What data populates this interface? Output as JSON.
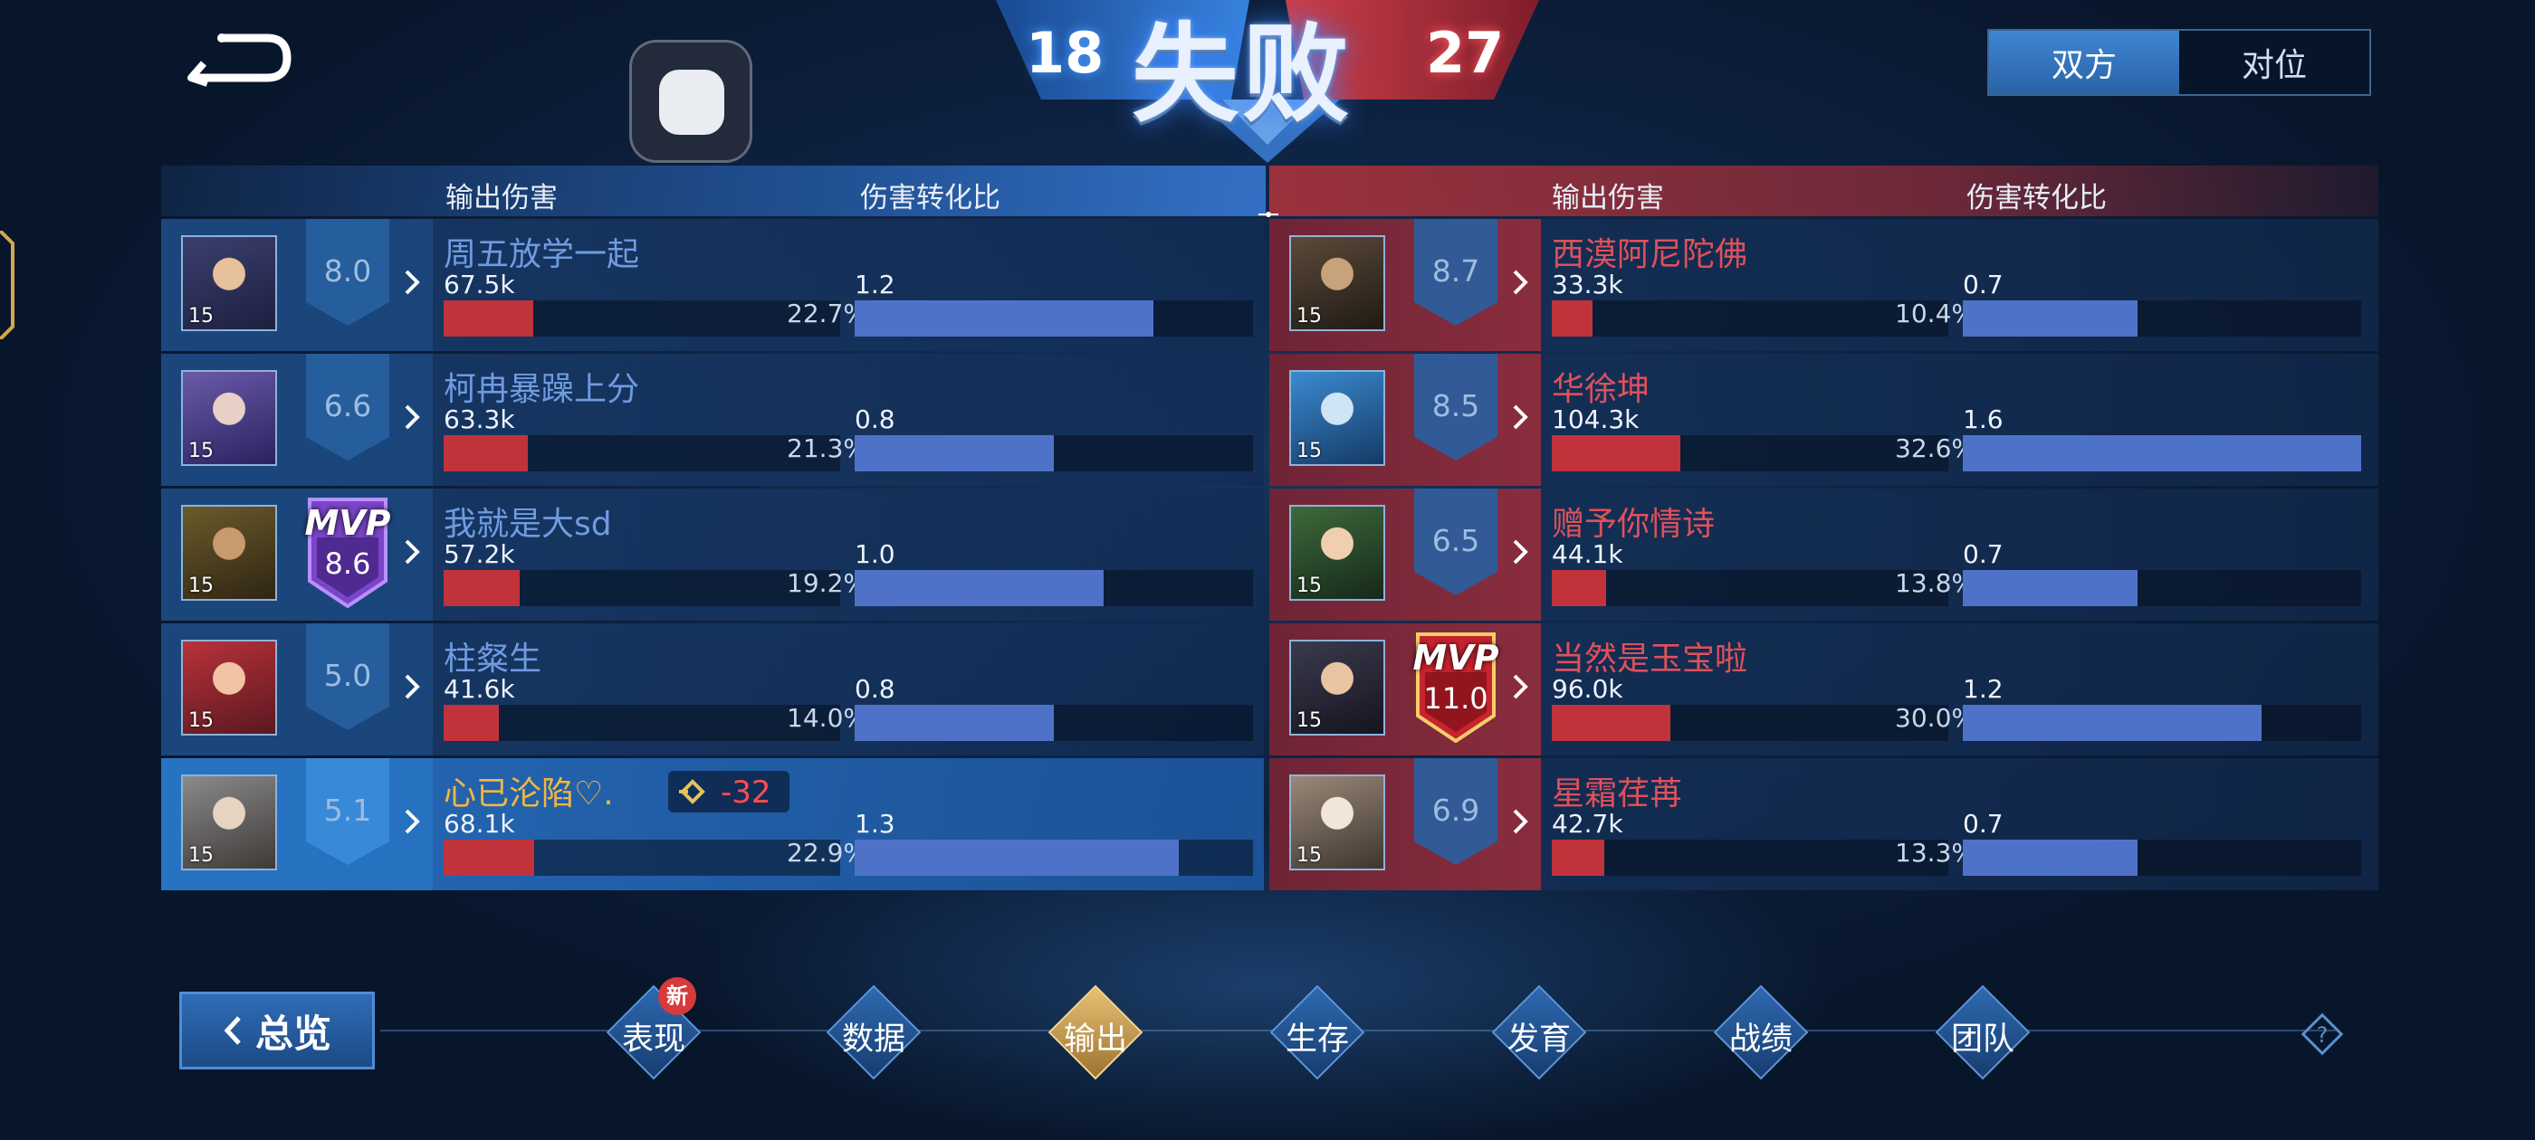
{
  "header": {
    "result": "失败",
    "score_ally": "18",
    "score_enemy": "27",
    "view_toggle": [
      {
        "label": "双方",
        "active": true
      },
      {
        "label": "对位",
        "active": false
      }
    ]
  },
  "columns": {
    "damage": "输出伤害",
    "conversion": "伤害转化比"
  },
  "ally": [
    {
      "name": "周五放学一起",
      "rating": "8.0",
      "level": "15",
      "damage": "67.5k",
      "damage_pct": "22.7%",
      "damage_share": 0.227,
      "ratio": "1.2",
      "ratio_value": 1.2,
      "mvp": false
    },
    {
      "name": "柯冉暴躁上分",
      "rating": "6.6",
      "level": "15",
      "damage": "63.3k",
      "damage_pct": "21.3%",
      "damage_share": 0.213,
      "ratio": "0.8",
      "ratio_value": 0.8,
      "mvp": false
    },
    {
      "name": "我就是大sd",
      "rating": "8.6",
      "level": "15",
      "damage": "57.2k",
      "damage_pct": "19.2%",
      "damage_share": 0.192,
      "ratio": "1.0",
      "ratio_value": 1.0,
      "mvp": true,
      "mvp_label": "MVP"
    },
    {
      "name": "柱粲生",
      "rating": "5.0",
      "level": "15",
      "damage": "41.6k",
      "damage_pct": "14.0%",
      "damage_share": 0.14,
      "ratio": "0.8",
      "ratio_value": 0.8,
      "mvp": false
    },
    {
      "name": "心已沦陷♡.",
      "rating": "5.1",
      "level": "15",
      "damage": "68.1k",
      "damage_pct": "22.9%",
      "damage_share": 0.229,
      "ratio": "1.3",
      "ratio_value": 1.3,
      "mvp": false,
      "is_self": true,
      "rank_change": "-32"
    }
  ],
  "enemy": [
    {
      "name": "西漠阿尼陀佛",
      "rating": "8.7",
      "level": "15",
      "damage": "33.3k",
      "damage_pct": "10.4%",
      "damage_share": 0.104,
      "ratio": "0.7",
      "ratio_value": 0.7,
      "mvp": false
    },
    {
      "name": "华徐坤",
      "rating": "8.5",
      "level": "15",
      "damage": "104.3k",
      "damage_pct": "32.6%",
      "damage_share": 0.326,
      "ratio": "1.6",
      "ratio_value": 1.6,
      "mvp": false
    },
    {
      "name": "赠予你情诗",
      "rating": "6.5",
      "level": "15",
      "damage": "44.1k",
      "damage_pct": "13.8%",
      "damage_share": 0.138,
      "ratio": "0.7",
      "ratio_value": 0.7,
      "mvp": false
    },
    {
      "name": "当然是玉宝啦",
      "rating": "11.0",
      "level": "15",
      "damage": "96.0k",
      "damage_pct": "30.0%",
      "damage_share": 0.3,
      "ratio": "1.2",
      "ratio_value": 1.2,
      "mvp": true,
      "mvp_label": "MVP"
    },
    {
      "name": "星霜荏苒",
      "rating": "6.9",
      "level": "15",
      "damage": "42.7k",
      "damage_pct": "13.3%",
      "damage_share": 0.133,
      "ratio": "0.7",
      "ratio_value": 0.7,
      "mvp": false
    }
  ],
  "ratio_scale_max": 1.6,
  "damage_scale_max": 0.326,
  "nav": {
    "overview": "总览",
    "tabs": [
      {
        "label": "表现",
        "badge": "新",
        "active": false
      },
      {
        "label": "数据",
        "active": false
      },
      {
        "label": "输出",
        "active": true
      },
      {
        "label": "生存",
        "active": false
      },
      {
        "label": "发育",
        "active": false
      },
      {
        "label": "战绩",
        "active": false
      },
      {
        "label": "团队",
        "active": false
      }
    ]
  },
  "colors": {
    "ally_name": "#6f9be0",
    "enemy_name": "#e0505a",
    "self_name": "#f2b73e",
    "damage_bar": "#c0333b",
    "ratio_bar": "#4f72c9",
    "active_tab": "#e8c174"
  },
  "icons": {
    "back": "return-arrow-icon",
    "floating": "floating-ball-icon",
    "chevron": "chevron-right-icon",
    "rank_change": "rank-arrow-icon",
    "overview_chevron": "chevron-left-icon",
    "help": "help-icon"
  }
}
